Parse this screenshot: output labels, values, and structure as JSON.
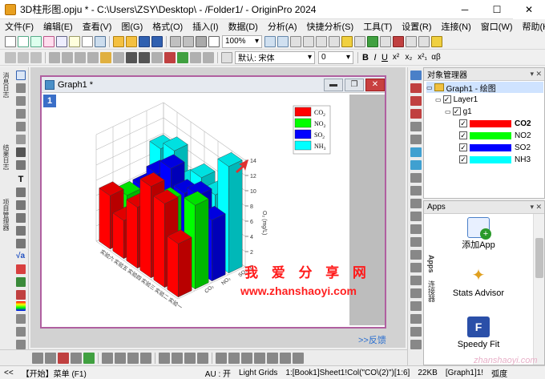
{
  "window": {
    "title": "3D柱形图.opju * - C:\\Users\\ZSY\\Desktop\\ - /Folder1/ - OriginPro 2024",
    "min": "─",
    "max": "☐",
    "close": "✕"
  },
  "menu": [
    "文件(F)",
    "编辑(E)",
    "查看(V)",
    "图(G)",
    "格式(O)",
    "插入(I)",
    "数据(D)",
    "分析(A)",
    "快捷分析(S)",
    "工具(T)",
    "设置(R)",
    "连接(N)",
    "窗口(W)",
    "帮助(H)"
  ],
  "toolbar": {
    "zoom": "100%",
    "font_label": "默认: 宋体",
    "font_size": "0",
    "format_buttons": [
      "B",
      "I",
      "U",
      "x²",
      "x₂",
      "x²₁",
      "αβ"
    ]
  },
  "left_labels": [
    "消息日志",
    "结果日志",
    "项目管理器",
    "对象管理器"
  ],
  "graph_window": {
    "title": "Graph1 *",
    "layer": "1",
    "feedback": ">>反馈"
  },
  "object_manager": {
    "title": "对象管理器",
    "tree": {
      "root": "Graph1 - 绘图",
      "layer": "Layer1",
      "group": "g1",
      "series": [
        {
          "name": "CO2",
          "color": "#ff0000",
          "bold": true
        },
        {
          "name": "NO2",
          "color": "#00ff00",
          "bold": false
        },
        {
          "name": "SO2",
          "color": "#0000ff",
          "bold": false
        },
        {
          "name": "NH3",
          "color": "#00ffff",
          "bold": false
        }
      ]
    }
  },
  "apps_panel": {
    "title": "Apps",
    "items": [
      "添加App",
      "Stats Advisor",
      "Speedy Fit"
    ],
    "side_tabs": [
      "Apps",
      "连接器"
    ]
  },
  "status": {
    "hint": "<<",
    "start": "【开始】菜单 (F1)",
    "au": "AU : 开",
    "light_grids": "Light Grids",
    "cell": "1:[Book1]Sheet1!Col(\"CO\\(2)\")[1:6]",
    "size": "22KB",
    "graph": "[Graph1]1!",
    "unit": "弧度"
  },
  "watermark": {
    "cn": "我 爱 分 享 网",
    "url": "www.zhanshaoyi.com",
    "corner": "zhanshaoyi.com"
  },
  "chart_data": {
    "type": "bar",
    "title": "",
    "legend": {
      "placement": "top-right",
      "entries": [
        {
          "name": "CO2",
          "label_main": "CO",
          "label_sub": "2",
          "color": "#ff0000"
        },
        {
          "name": "NO2",
          "label_main": "NO",
          "label_sub": "2",
          "color": "#00ff00"
        },
        {
          "name": "SO2",
          "label_main": "SO",
          "label_sub": "2",
          "color": "#0000ff"
        },
        {
          "name": "NH3",
          "label_main": "NH",
          "label_sub": "3",
          "color": "#00ffff"
        }
      ]
    },
    "zlabel": "O₂ (mg/L)",
    "zlim": [
      0,
      14
    ],
    "z_ticks": [
      "0",
      "2",
      "4",
      "6",
      "8",
      "10",
      "12",
      "14"
    ],
    "categories": [
      "实验一",
      "实验二",
      "实验三",
      "实验四",
      "实验五",
      "实验六"
    ],
    "x_ticks": [
      "实验六",
      "实验五",
      "实验四",
      "实验三",
      "实验二",
      "实验一"
    ],
    "y_ticks": [
      "SO₂",
      "NO₂",
      "CO₂"
    ],
    "series": [
      {
        "name": "CO2",
        "values": [
          7,
          11,
          12,
          8,
          5,
          7
        ]
      },
      {
        "name": "NO2",
        "values": [
          11,
          4,
          9,
          5,
          3,
          6
        ]
      },
      {
        "name": "SO2",
        "values": [
          8,
          10,
          9,
          11,
          9,
          6
        ]
      },
      {
        "name": "NH3",
        "values": [
          14,
          9,
          10,
          8,
          11,
          10
        ]
      }
    ]
  }
}
